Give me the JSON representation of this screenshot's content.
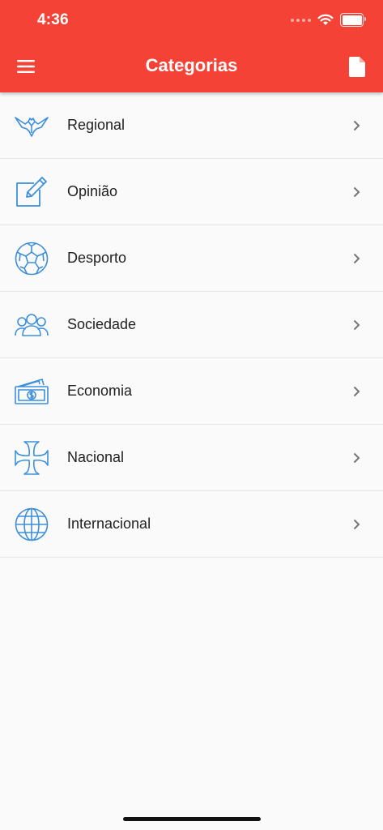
{
  "status_bar": {
    "time": "4:36"
  },
  "app_bar": {
    "title": "Categorias",
    "background_color": "#f44336",
    "menu_icon": "hamburger-menu-icon",
    "action_icon": "document-icon"
  },
  "categories": [
    {
      "label": "Regional",
      "icon": "eagle-icon"
    },
    {
      "label": "Opinião",
      "icon": "edit-note-icon"
    },
    {
      "label": "Desporto",
      "icon": "soccer-ball-icon"
    },
    {
      "label": "Sociedade",
      "icon": "people-group-icon"
    },
    {
      "label": "Economia",
      "icon": "money-icon"
    },
    {
      "label": "Nacional",
      "icon": "cross-icon"
    },
    {
      "label": "Internacional",
      "icon": "globe-icon"
    }
  ],
  "colors": {
    "icon_blue": "#3d8fdc",
    "chevron": "#757575",
    "text": "#212121"
  }
}
